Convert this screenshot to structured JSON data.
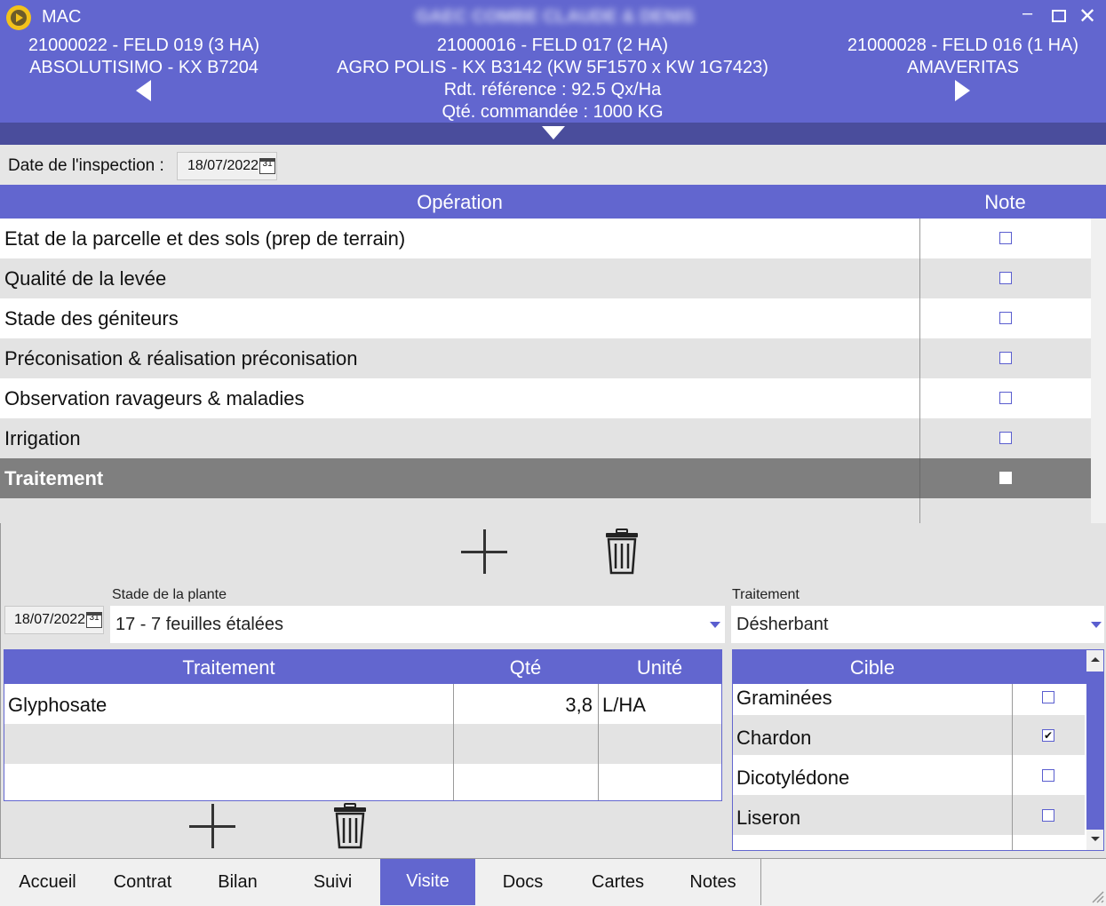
{
  "window": {
    "app_title": "MAC",
    "client_name": "GAEC COMBE CLAUDE & DENIS"
  },
  "header": {
    "left": {
      "line1": "21000022 - FELD 019 (3 HA)",
      "line2": "ABSOLUTISIMO - KX B7204"
    },
    "center": {
      "line1": "21000016 - FELD 017 (2 HA)",
      "line2": "AGRO POLIS - KX B3142 (KW 5F1570 x KW 1G7423)",
      "line3": "Rdt. référence : 92.5 Qx/Ha",
      "line4": "Qté. commandée : 1000 KG"
    },
    "right": {
      "line1": "21000028 - FELD 016 (1 HA)",
      "line2": "AMAVERITAS"
    }
  },
  "inspection": {
    "label": "Date de l'inspection :",
    "date": "18/07/2022"
  },
  "operations": {
    "col_operation": "Opération",
    "col_note": "Note",
    "rows": [
      {
        "label": "Etat de la parcelle et des sols (prep de terrain)",
        "checked": false
      },
      {
        "label": "Qualité de la levée",
        "checked": false
      },
      {
        "label": "Stade des géniteurs",
        "checked": false
      },
      {
        "label": "Préconisation & réalisation préconisation",
        "checked": false
      },
      {
        "label": "Observation ravageurs & maladies",
        "checked": false
      },
      {
        "label": "Irrigation",
        "checked": false
      },
      {
        "label": "Traitement",
        "checked": false,
        "selected": true
      }
    ]
  },
  "treatment_form": {
    "date": "18/07/2022",
    "stade_label": "Stade de la plante",
    "stade_value": "17 - 7 feuilles étalées",
    "traitement_label": "Traitement",
    "traitement_value": "Désherbant"
  },
  "treatment_table": {
    "col_traitement": "Traitement",
    "col_qte": "Qté",
    "col_unite": "Unité",
    "rows": [
      {
        "traitement": "Glyphosate",
        "qte": "3,8",
        "unite": "L/HA"
      },
      {
        "traitement": "",
        "qte": "",
        "unite": ""
      },
      {
        "traitement": "",
        "qte": "",
        "unite": ""
      }
    ]
  },
  "cible_table": {
    "col_cible": "Cible",
    "rows": [
      {
        "label": "Graminées",
        "checked": false
      },
      {
        "label": "Chardon",
        "checked": true
      },
      {
        "label": "Dicotylédone",
        "checked": false
      },
      {
        "label": "Liseron",
        "checked": false
      }
    ]
  },
  "tabs": [
    "Accueil",
    "Contrat",
    "Bilan",
    "Suivi",
    "Visite",
    "Docs",
    "Cartes",
    "Notes"
  ],
  "active_tab": "Visite",
  "colors": {
    "accent": "#6266cf",
    "selected_row": "#7f7f7f",
    "dark_bar": "#4a4d9c"
  }
}
